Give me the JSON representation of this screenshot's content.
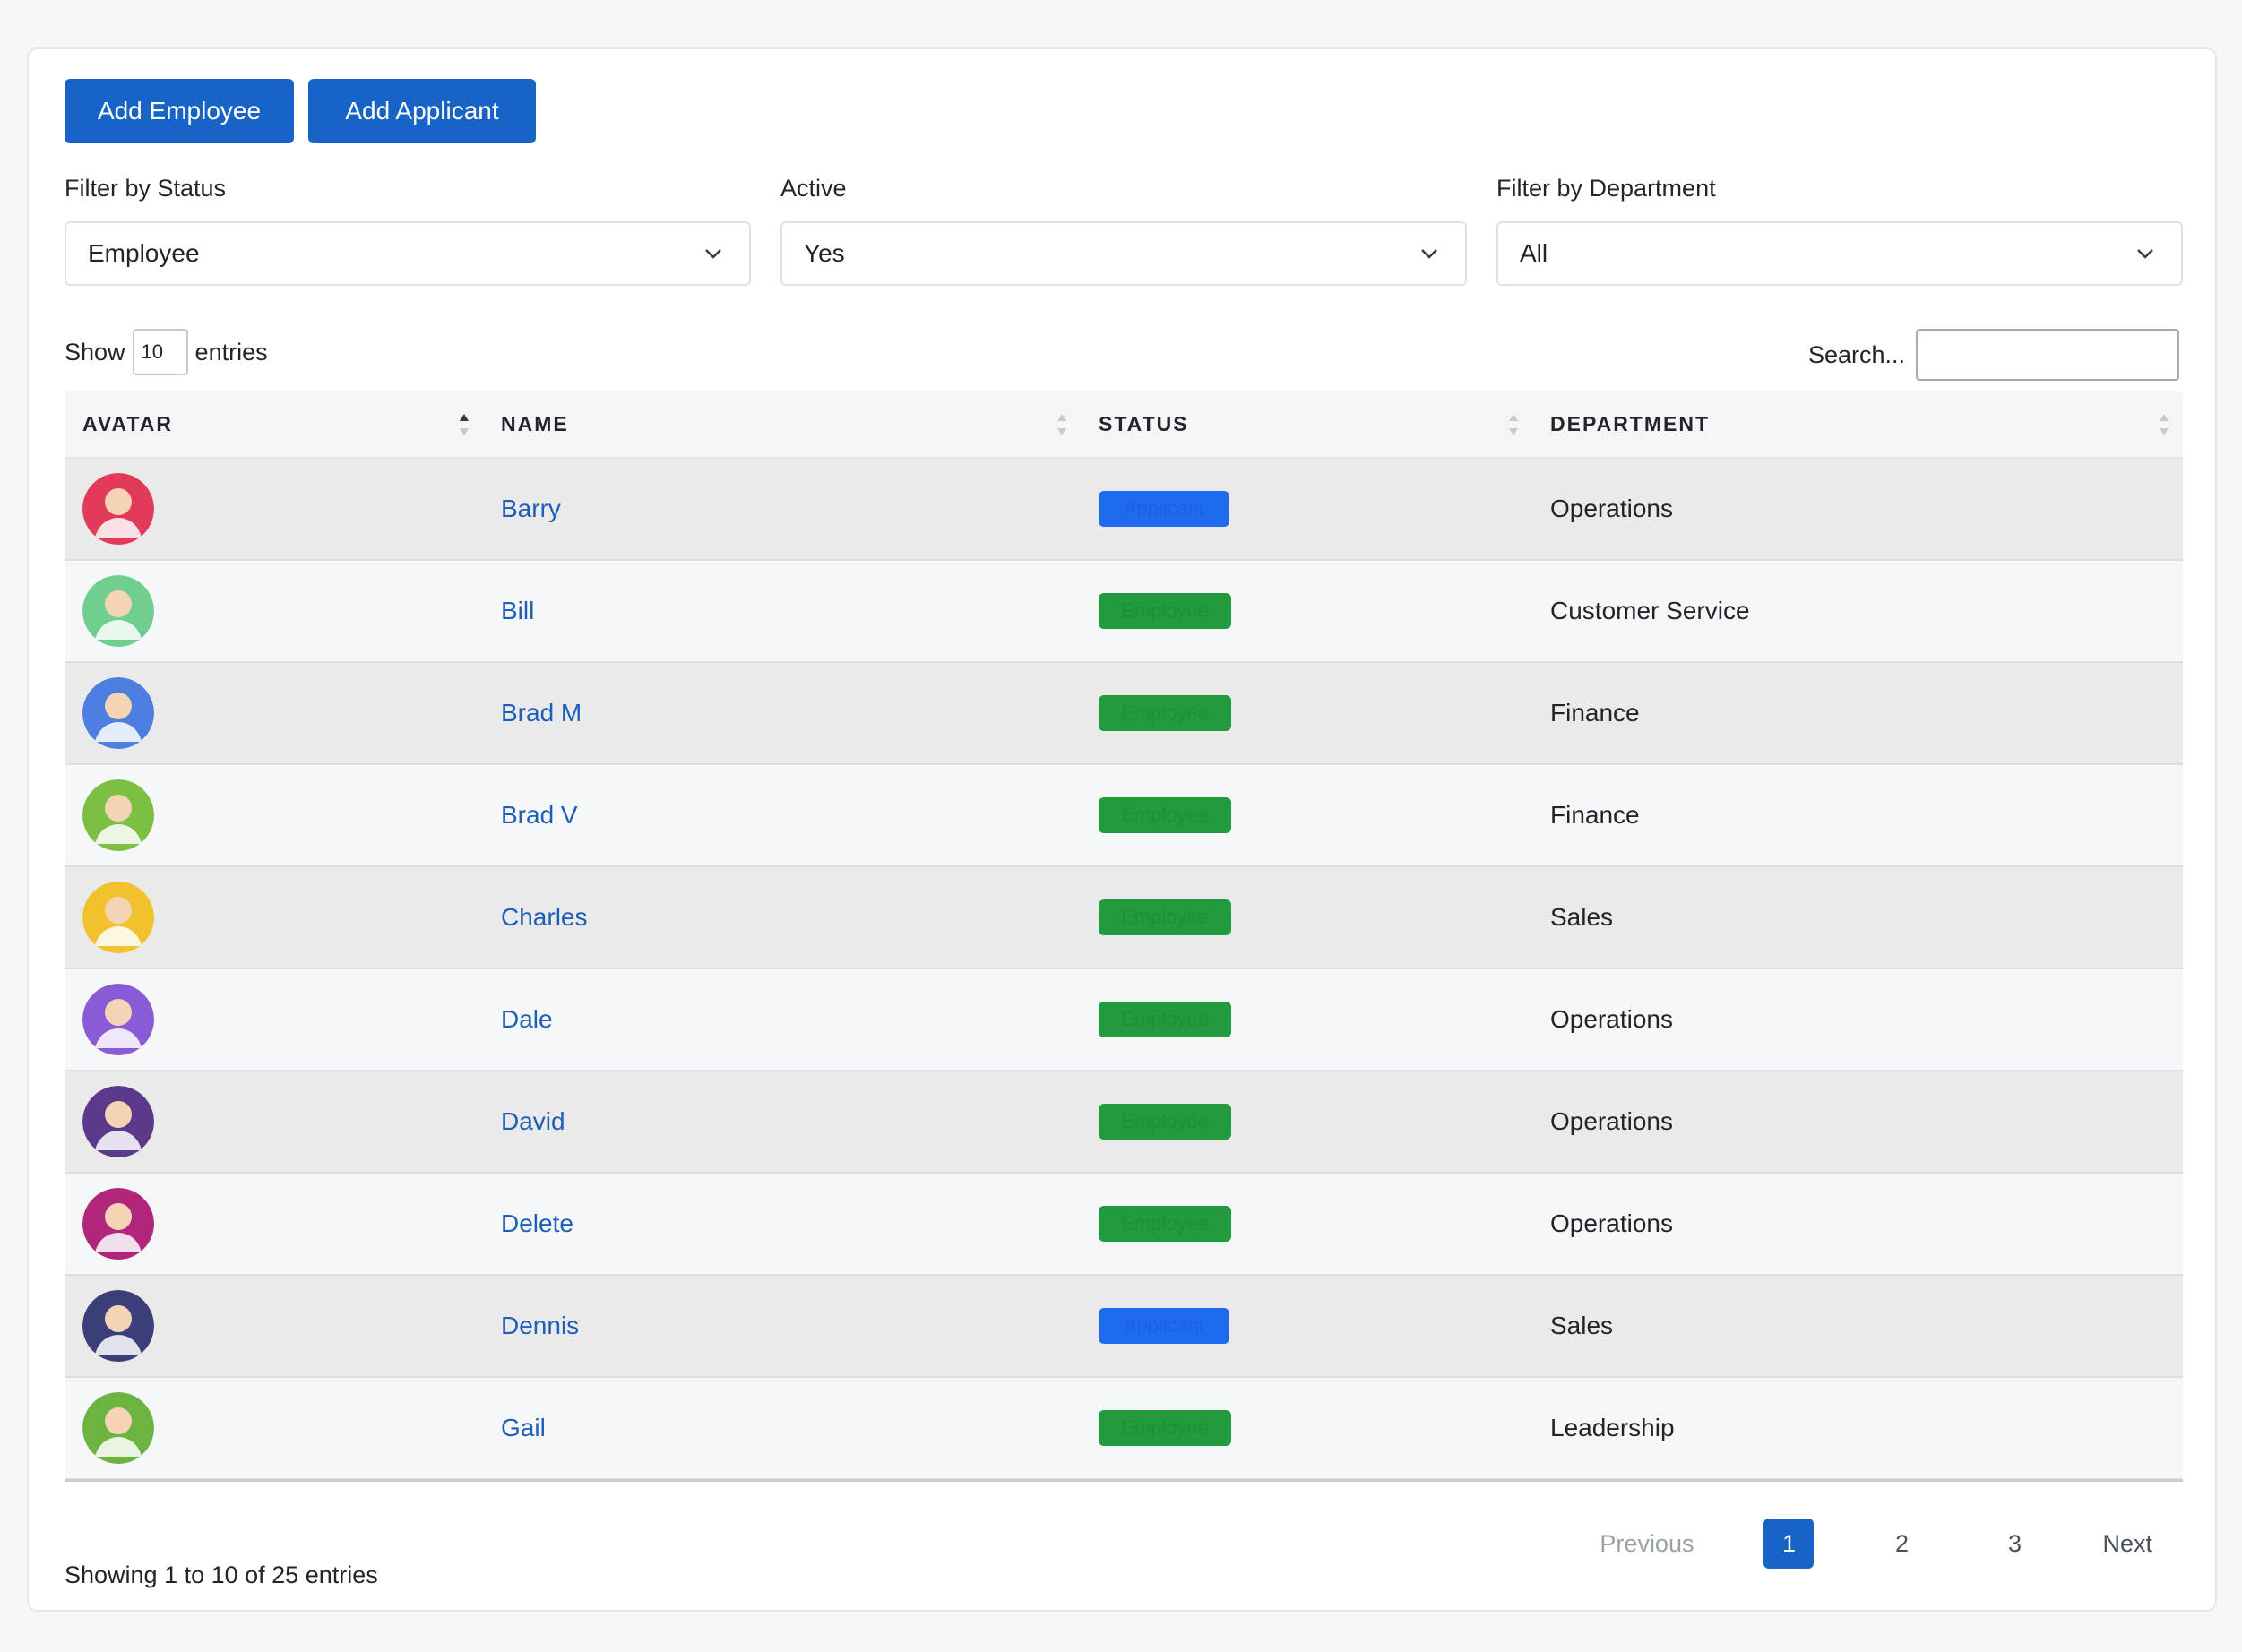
{
  "toolbar": {
    "add_employee": "Add Employee",
    "add_applicant": "Add Applicant"
  },
  "filters": [
    {
      "label": "Filter by Status",
      "value": "Employee"
    },
    {
      "label": "Active",
      "value": "Yes"
    },
    {
      "label": "Filter by Department",
      "value": "All"
    }
  ],
  "length": {
    "prefix": "Show",
    "value": "10",
    "suffix": "entries"
  },
  "search": {
    "label": "Search..."
  },
  "columns": [
    "AVATAR",
    "NAME",
    "STATUS",
    "DEPARTMENT"
  ],
  "rows": [
    {
      "name": "Barry",
      "status": "Applicant",
      "department": "Operations",
      "avatar_color": "#e23b5a"
    },
    {
      "name": "Bill",
      "status": "Employee",
      "department": "Customer Service",
      "avatar_color": "#6fcf8f"
    },
    {
      "name": "Brad M",
      "status": "Employee",
      "department": "Finance",
      "avatar_color": "#4c7fe0"
    },
    {
      "name": "Brad V",
      "status": "Employee",
      "department": "Finance",
      "avatar_color": "#7bc043"
    },
    {
      "name": "Charles",
      "status": "Employee",
      "department": "Sales",
      "avatar_color": "#f2c12e"
    },
    {
      "name": "Dale",
      "status": "Employee",
      "department": "Operations",
      "avatar_color": "#8a5bd6"
    },
    {
      "name": "David",
      "status": "Employee",
      "department": "Operations",
      "avatar_color": "#5b3a8c"
    },
    {
      "name": "Delete",
      "status": "Employee",
      "department": "Operations",
      "avatar_color": "#b0267a"
    },
    {
      "name": "Dennis",
      "status": "Applicant",
      "department": "Sales",
      "avatar_color": "#3a3f7a"
    },
    {
      "name": "Gail",
      "status": "Employee",
      "department": "Leadership",
      "avatar_color": "#6db33f"
    }
  ],
  "footer": {
    "info": "Showing 1 to 10 of 25 entries"
  },
  "pagination": {
    "previous": "Previous",
    "pages": [
      "1",
      "2",
      "3"
    ],
    "active": "1",
    "next": "Next"
  },
  "colors": {
    "primary": "#1763c6",
    "employee_badge": "#219b3d",
    "applicant_badge": "#1f6bf0",
    "link": "#1d5fb8"
  }
}
